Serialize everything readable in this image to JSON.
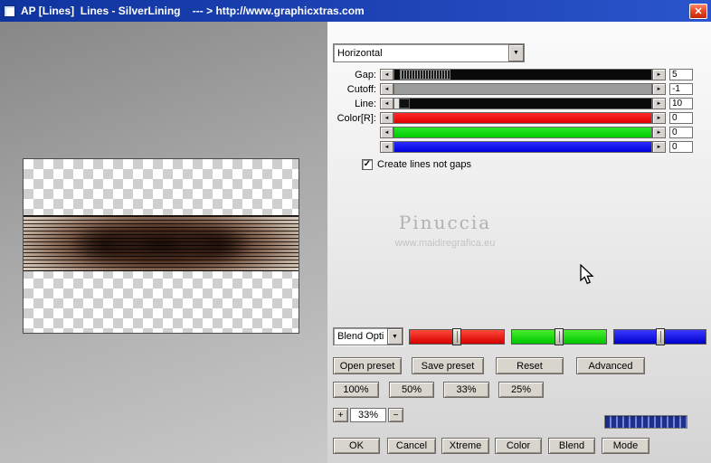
{
  "titlebar": {
    "title": "AP [Lines]  Lines - SilverLining    --- > http://www.graphicxtras.com"
  },
  "icons": {
    "close": "✕",
    "dropdown": "▼",
    "left": "◄",
    "right": "►",
    "check": "✓"
  },
  "panel": {
    "mode_select": "Horizontal",
    "sliders": [
      {
        "label": "Gap:",
        "value": "5"
      },
      {
        "label": "Cutoff:",
        "value": "-1"
      },
      {
        "label": "Line:",
        "value": "10"
      },
      {
        "label": "Color[R]:",
        "value": "0"
      },
      {
        "label": "",
        "value": "0"
      },
      {
        "label": "",
        "value": "0"
      }
    ],
    "checkbox_label": "Create lines not gaps",
    "blend_select": "Blend Opti",
    "preset_buttons": [
      "Open preset",
      "Save preset",
      "Reset",
      "Advanced"
    ],
    "percent_buttons": [
      "100%",
      "50%",
      "33%",
      "25%"
    ],
    "zoom": {
      "in": "+",
      "value": "33%",
      "out": "−"
    },
    "action_buttons": [
      "OK",
      "Cancel",
      "Xtreme",
      "Color",
      "Blend",
      "Mode"
    ]
  },
  "watermark": {
    "line1": "Pinuccia",
    "line2": "www.maidiregrafica.eu"
  },
  "colors": {
    "titlebar_blue": "#1e43b5",
    "slider_red": "#ff0000",
    "slider_green": "#00cc00",
    "slider_blue": "#0000dd",
    "meter_blue": "#1f2f8e"
  }
}
